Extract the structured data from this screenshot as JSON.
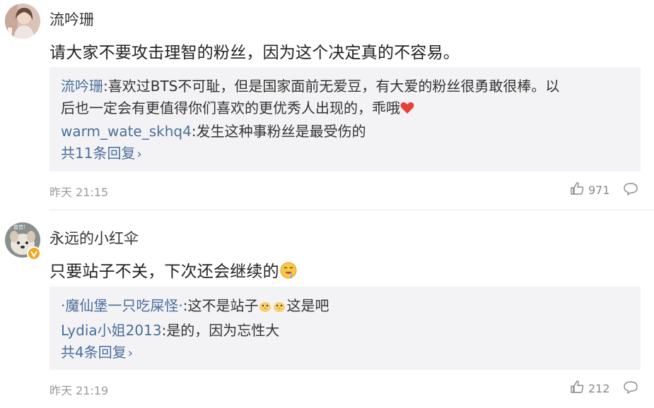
{
  "comments": [
    {
      "username": "流吟珊",
      "content": "请大家不要攻击理智的粉丝，因为这个决定真的不容易。",
      "replies": [
        {
          "user": "流吟珊",
          "sep": ":",
          "text": "喜欢过BTS不可耻，但是国家面前无爱豆，有大爱的粉丝很勇敢很棒。以",
          "text2": "后也一定会有更值得你们喜欢的更优秀人出现的，乖哦"
        },
        {
          "user": "warm_wate_skhq4",
          "sep": ":",
          "text": "发生这种事粉丝是最受伤的"
        }
      ],
      "more_replies": "共11条回复",
      "time": "昨天 21:15",
      "likes": "971"
    },
    {
      "username": "永远的小红伞",
      "content": "只要站子不关，下次还会继续的",
      "replies": [
        {
          "user": "·魔仙堡一只吃屎怪·",
          "sep": ":",
          "text": "这不是站子",
          "text_after": "这是吧"
        },
        {
          "user": "Lydia小姐2013",
          "sep": ":",
          "text": "是的，因为忘性大"
        }
      ],
      "more_replies": "共4条回复",
      "time": "昨天 21:19",
      "likes": "212",
      "avatar_label": "曾觉！"
    }
  ],
  "icons": {
    "like": "thumbs-up-icon",
    "reply": "comment-bubble-icon",
    "heart": "heart-emoji",
    "drool": "drooling-face-emoji",
    "chick": "chick-emoji"
  },
  "colors": {
    "link": "#4a6e9a",
    "reply_bg": "#f3f3f5",
    "meta": "#999999",
    "heart": "#e8403a",
    "verified": "#f5a623"
  }
}
